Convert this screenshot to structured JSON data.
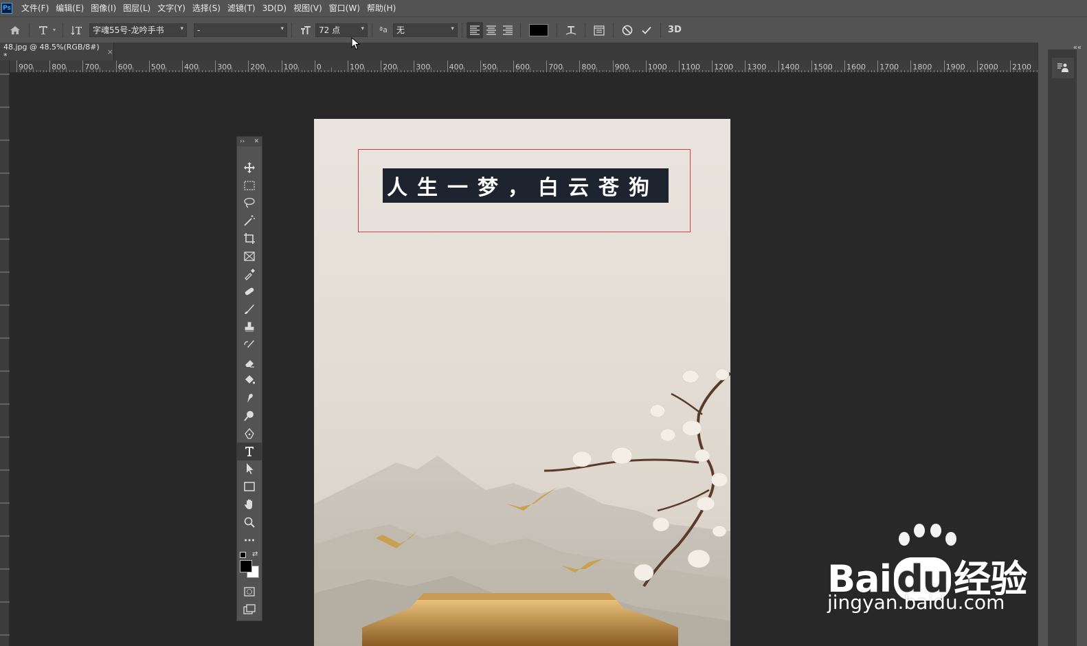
{
  "menubar": {
    "app_icon": "Ps",
    "items": [
      "文件(F)",
      "编辑(E)",
      "图像(I)",
      "图层(L)",
      "文字(Y)",
      "选择(S)",
      "滤镜(T)",
      "3D(D)",
      "视图(V)",
      "窗口(W)",
      "帮助(H)"
    ]
  },
  "options": {
    "font_family": "字魂55号-龙吟手书",
    "font_style": "-",
    "font_size": "72 点",
    "antialias_label": "ªa",
    "antialias": "无",
    "color": "#000000",
    "three_d_label": "3D"
  },
  "document": {
    "tab_title": "48.jpg @ 48.5%(RGB/8#) *",
    "close_label": "×",
    "edit_text": "人生一梦，白云苍狗"
  },
  "ruler": {
    "labels": [
      "900",
      "800",
      "700",
      "600",
      "500",
      "400",
      "300",
      "200",
      "100",
      "0",
      "100",
      "200",
      "300",
      "400",
      "500",
      "600",
      "700",
      "800",
      "900",
      "1000",
      "1100",
      "1200",
      "1300",
      "1400",
      "1500",
      "1600",
      "1700",
      "1800",
      "1900",
      "2000",
      "2100"
    ]
  },
  "toolbar": {
    "tools": [
      "move-tool",
      "marquee-tool",
      "lasso-tool",
      "magic-wand-tool",
      "crop-tool",
      "frame-tool",
      "eyedropper-tool",
      "healing-brush-tool",
      "brush-tool",
      "clone-stamp-tool",
      "history-brush-tool",
      "eraser-tool",
      "paint-bucket-tool",
      "smudge-tool",
      "dodge-tool",
      "pen-tool",
      "type-tool",
      "path-selection-tool",
      "rectangle-tool",
      "hand-tool",
      "zoom-tool",
      "more-tools"
    ],
    "active": "type-tool",
    "foreground": "#000000",
    "background": "#ffffff"
  },
  "watermark": {
    "brand": "Bai 经验",
    "brand_bai": "Bai",
    "brand_du": "du",
    "brand_jingyan": "经验",
    "url": "jingyan.baidu.com"
  }
}
